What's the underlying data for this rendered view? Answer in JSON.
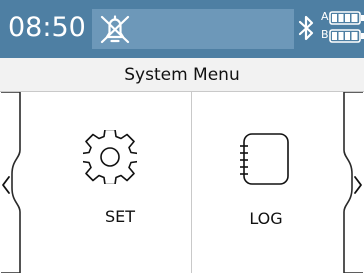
{
  "status_bar": {
    "time": "08:50",
    "alarm_icon": "alarm-silenced-icon",
    "bluetooth_icon": "bluetooth-icon",
    "battery_a_label": "A",
    "battery_b_label": "B",
    "battery_a_level": 0.9,
    "battery_b_level": 0.9,
    "background_color": "#4e7fa3"
  },
  "header": {
    "title": "System Menu"
  },
  "menu": {
    "items": [
      {
        "label": "SET",
        "icon": "gear-icon"
      },
      {
        "label": "LOG",
        "icon": "log-icon"
      }
    ],
    "prev_icon": "chevron-left-icon",
    "next_icon": "chevron-right-icon"
  }
}
